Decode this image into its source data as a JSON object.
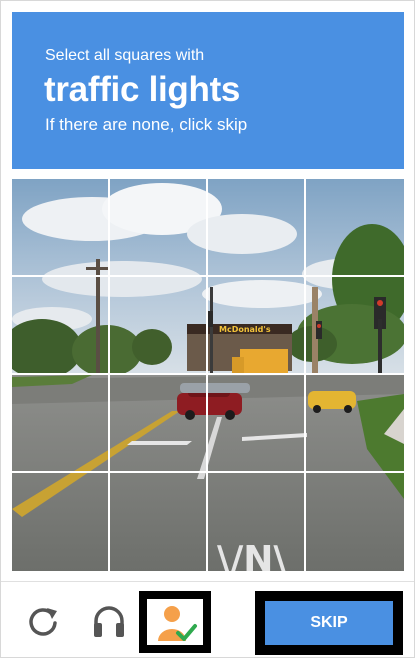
{
  "header": {
    "instruction": "Select all squares with",
    "target": "traffic lights",
    "hint": "If there are none, click skip"
  },
  "grid": {
    "rows": 4,
    "cols": 4
  },
  "footer": {
    "reload_icon": "reload-icon",
    "audio_icon": "headphones-icon",
    "info_icon": "person-check-icon",
    "skip_label": "SKIP"
  },
  "colors": {
    "accent": "#4a90e2",
    "check": "#2fa94e",
    "person": "#f5a04a"
  }
}
